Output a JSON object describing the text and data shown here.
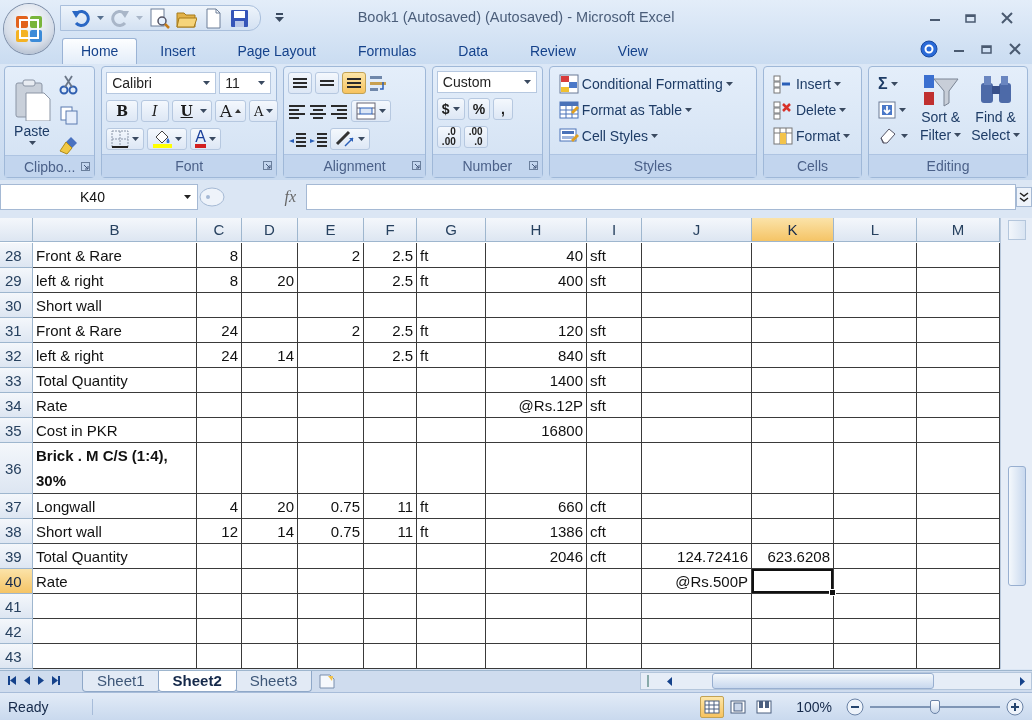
{
  "window": {
    "title": "Book1 (Autosaved) (Autosaved) - Microsoft Excel"
  },
  "tabs": [
    {
      "label": "Home",
      "selected": true
    },
    {
      "label": "Insert",
      "selected": false
    },
    {
      "label": "Page Layout",
      "selected": false
    },
    {
      "label": "Formulas",
      "selected": false
    },
    {
      "label": "Data",
      "selected": false
    },
    {
      "label": "Review",
      "selected": false
    },
    {
      "label": "View",
      "selected": false
    }
  ],
  "ribbon": {
    "clipboard": {
      "label": "Clipbo...",
      "paste": "Paste"
    },
    "font": {
      "label": "Font",
      "name": "Calibri",
      "size": "11",
      "bold": "B",
      "italic": "I",
      "underline": "U",
      "grow": "A",
      "shrink": "A",
      "font_color_label": "A"
    },
    "alignment": {
      "label": "Alignment",
      "vertical": [
        {
          "kind": "top",
          "selected": false
        },
        {
          "kind": "middle",
          "selected": false
        },
        {
          "kind": "bottom",
          "selected": true
        }
      ]
    },
    "number": {
      "label": "Number",
      "format": "Custom",
      "currency": "$",
      "percent": "%",
      "comma": ",",
      "decimals": [
        {
          "top": ".0",
          "bottom": ".00"
        },
        {
          "top": ".00",
          "bottom": ".0"
        }
      ]
    },
    "styles": {
      "label": "Styles",
      "items": [
        {
          "kind": "conditional",
          "label": "Conditional Formatting"
        },
        {
          "kind": "table",
          "label": "Format as Table"
        },
        {
          "kind": "cellstyles",
          "label": "Cell Styles"
        }
      ]
    },
    "cells": {
      "label": "Cells",
      "items": [
        {
          "kind": "insert",
          "label": "Insert"
        },
        {
          "kind": "delete",
          "label": "Delete"
        },
        {
          "kind": "format",
          "label": "Format"
        }
      ]
    },
    "editing": {
      "label": "Editing",
      "sum": "Σ",
      "sort": [
        "Sort &",
        "Filter"
      ],
      "find": [
        "Find &",
        "Select"
      ]
    }
  },
  "formula_bar": {
    "name_box": "K40",
    "function_label": "fx"
  },
  "sheet": {
    "columns": [
      {
        "label": "B",
        "selected": false
      },
      {
        "label": "C",
        "selected": false
      },
      {
        "label": "D",
        "selected": false
      },
      {
        "label": "E",
        "selected": false
      },
      {
        "label": "F",
        "selected": false
      },
      {
        "label": "G",
        "selected": false
      },
      {
        "label": "H",
        "selected": false
      },
      {
        "label": "I",
        "selected": false
      },
      {
        "label": "J",
        "selected": false
      },
      {
        "label": "K",
        "selected": true
      },
      {
        "label": "L",
        "selected": false
      },
      {
        "label": "M",
        "selected": false
      }
    ],
    "rows": [
      {
        "number": "28",
        "selected": false,
        "bold": false,
        "cells": {
          "B": "Front & Rare",
          "C": "8",
          "E": "2",
          "F": "2.5",
          "G": "ft",
          "H": "40",
          "I": "sft"
        }
      },
      {
        "number": "29",
        "selected": false,
        "bold": false,
        "cells": {
          "B": "left & right",
          "C": "8",
          "D": "20",
          "F": "2.5",
          "G": "ft",
          "H": "400",
          "I": "sft"
        }
      },
      {
        "number": "30",
        "selected": false,
        "bold": false,
        "cells": {
          "B": "Short wall"
        }
      },
      {
        "number": "31",
        "selected": false,
        "bold": false,
        "cells": {
          "B": "Front & Rare",
          "C": "24",
          "E": "2",
          "F": "2.5",
          "G": "ft",
          "H": "120",
          "I": "sft"
        }
      },
      {
        "number": "32",
        "selected": false,
        "bold": false,
        "cells": {
          "B": "left & right",
          "C": "24",
          "D": "14",
          "F": "2.5",
          "G": "ft",
          "H": "840",
          "I": "sft"
        }
      },
      {
        "number": "33",
        "selected": false,
        "bold": false,
        "cells": {
          "B": "Total Quantity",
          "H": "1400",
          "I": "sft"
        }
      },
      {
        "number": "34",
        "selected": false,
        "bold": false,
        "cells": {
          "B": "Rate",
          "H": "@Rs.12P",
          "I": "sft"
        }
      },
      {
        "number": "35",
        "selected": false,
        "bold": false,
        "cells": {
          "B": "Cost in PKR",
          "H": "16800"
        }
      },
      {
        "number": "36",
        "selected": false,
        "bold": true,
        "cells": {
          "B": "Brick . M C/S (1:4), 30%"
        }
      },
      {
        "number": "37",
        "selected": false,
        "bold": false,
        "cells": {
          "B": "Longwall",
          "C": "4",
          "D": "20",
          "E": "0.75",
          "F": "11",
          "G": "ft",
          "H": "660",
          "I": "cft"
        }
      },
      {
        "number": "38",
        "selected": false,
        "bold": false,
        "cells": {
          "B": "Short wall",
          "C": "12",
          "D": "14",
          "E": "0.75",
          "F": "11",
          "G": "ft",
          "H": "1386",
          "I": "cft"
        }
      },
      {
        "number": "39",
        "selected": false,
        "bold": false,
        "cells": {
          "B": "Total Quantity",
          "H": "2046",
          "I": "cft",
          "J": "124.72416",
          "K": "623.6208"
        }
      },
      {
        "number": "40",
        "selected": true,
        "bold": false,
        "cells": {
          "B": "Rate",
          "J": "@Rs.500P"
        }
      },
      {
        "number": "41",
        "selected": false,
        "bold": false,
        "cells": {}
      },
      {
        "number": "42",
        "selected": false,
        "bold": false,
        "cells": {}
      },
      {
        "number": "43",
        "selected": false,
        "bold": false,
        "cells": {}
      }
    ]
  },
  "sheet_tabs": [
    {
      "label": "Sheet1",
      "selected": false
    },
    {
      "label": "Sheet2",
      "selected": true
    },
    {
      "label": "Sheet3",
      "selected": false
    }
  ],
  "status_bar": {
    "status": "Ready",
    "views": [
      {
        "kind": "normal",
        "selected": true
      },
      {
        "kind": "layout",
        "selected": false
      },
      {
        "kind": "pagebreak",
        "selected": false
      }
    ],
    "zoom": "100%",
    "zoom_slider": {
      "level": 0.5
    }
  }
}
